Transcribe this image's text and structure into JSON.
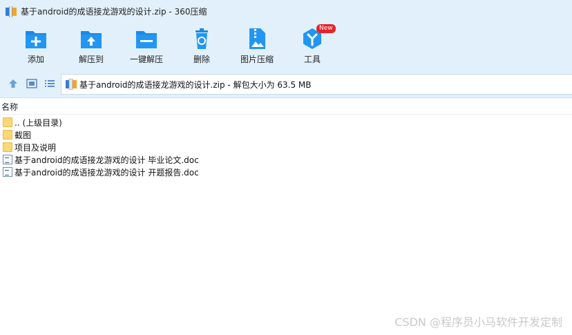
{
  "window": {
    "title": "基于android的成语接龙游戏的设计.zip - 360压缩"
  },
  "toolbar": {
    "buttons": [
      {
        "label": "添加",
        "icon": "add-folder-icon"
      },
      {
        "label": "解压到",
        "icon": "extract-to-icon"
      },
      {
        "label": "一键解压",
        "icon": "one-click-extract-icon"
      },
      {
        "label": "删除",
        "icon": "trash-icon"
      },
      {
        "label": "图片压缩",
        "icon": "image-compress-icon"
      },
      {
        "label": "工具",
        "icon": "tools-icon",
        "badge": "New"
      }
    ],
    "accent": "#1e88e5"
  },
  "nav": {
    "path": "基于android的成语接龙游戏的设计.zip - 解包大小为 63.5 MB"
  },
  "list": {
    "header": "名称",
    "items": [
      {
        "name": ".. (上级目录)",
        "type": "folder"
      },
      {
        "name": "截图",
        "type": "folder"
      },
      {
        "name": "项目及说明",
        "type": "folder"
      },
      {
        "name": "基于android的成语接龙游戏的设计 毕业论文.doc",
        "type": "doc"
      },
      {
        "name": "基于android的成语接龙游戏的设计 开题报告.doc",
        "type": "doc"
      }
    ]
  },
  "watermark": "CSDN @程序员小马软件开发定制"
}
